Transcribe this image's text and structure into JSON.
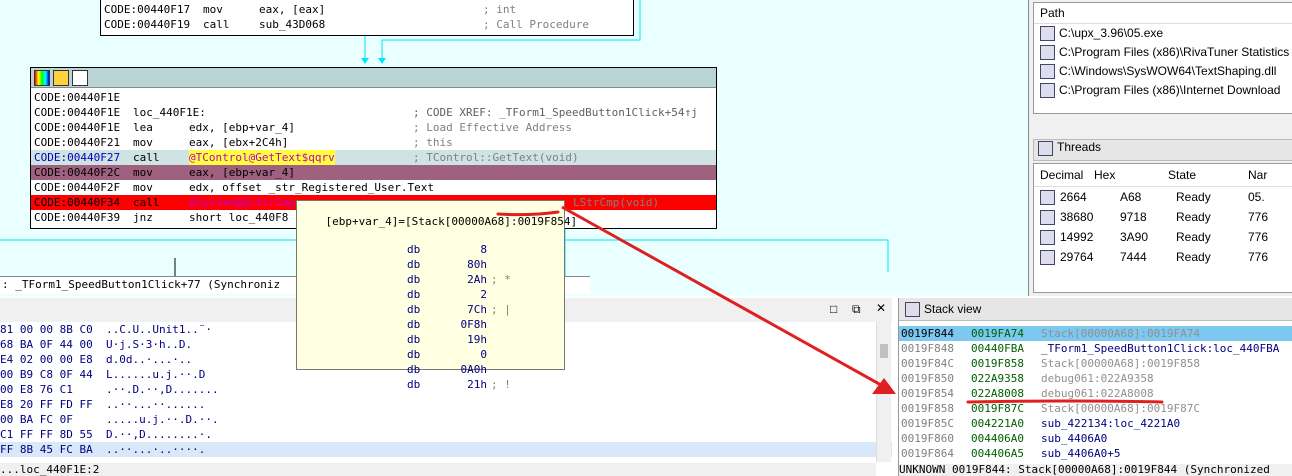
{
  "graph": {
    "top_node": {
      "lines": [
        {
          "addr": "CODE:00440F17",
          "mn": "mov",
          "op": "eax, [eax]",
          "cmt": "; int"
        },
        {
          "addr": "CODE:00440F19",
          "mn": "call",
          "op": "sub_43D068",
          "cmt": "; Call Procedure"
        }
      ]
    },
    "main_node": {
      "lines": [
        {
          "addr": "CODE:00440F1E",
          "mn": "",
          "op": "",
          "cmt": ""
        },
        {
          "addr": "CODE:00440F1E",
          "mn": "loc_440F1E:",
          "op": "",
          "cmt": "; CODE XREF: _TForm1_SpeedButton1Click+54↑j"
        },
        {
          "addr": "CODE:00440F1E",
          "mn": "lea",
          "op": "edx, [ebp+var_4]",
          "cmt": "; Load Effective Address"
        },
        {
          "addr": "CODE:00440F21",
          "mn": "mov",
          "op": "eax, [ebx+2C4h]",
          "cmt": "; this"
        },
        {
          "addr": "CODE:00440F27",
          "mn": "call",
          "op": "@TControl@GetText$qqrv",
          "cmt": "; TControl::GetText(void)"
        },
        {
          "addr": "CODE:00440F2C",
          "mn": "mov",
          "op": "eax, [ebp+var_4]",
          "cmt": ""
        },
        {
          "addr": "CODE:00440F2F",
          "mn": "mov",
          "op": "edx, offset _str_Registered_User.Text",
          "cmt": ""
        },
        {
          "addr": "CODE:00440F34",
          "mn": "call",
          "op": "@System@@LStrCmp",
          "cmt": "LStrCmp(void)"
        },
        {
          "addr": "CODE:00440F39",
          "mn": "jnz",
          "op": "short loc_440F8",
          "cmt": ""
        }
      ]
    }
  },
  "tooltip": {
    "header_prefix": "[ebp+var_4]=[Stack[00000A68]:",
    "header_addr": "0019F854",
    "header_suffix": "]",
    "lines": [
      {
        "kw": "db",
        "val": "8",
        "cmt": ""
      },
      {
        "kw": "db",
        "val": "80h",
        "cmt": ""
      },
      {
        "kw": "db",
        "val": "2Ah",
        "cmt": "; *"
      },
      {
        "kw": "db",
        "val": "2",
        "cmt": ""
      },
      {
        "kw": "db",
        "val": "7Ch",
        "cmt": "; |"
      },
      {
        "kw": "db",
        "val": "0F8h",
        "cmt": ""
      },
      {
        "kw": "db",
        "val": "19h",
        "cmt": ""
      },
      {
        "kw": "db",
        "val": "0",
        "cmt": ""
      },
      {
        "kw": "db",
        "val": "0A0h",
        "cmt": ""
      },
      {
        "kw": "db",
        "val": "21h",
        "cmt": "; !"
      }
    ]
  },
  "status_bar": {
    "text": ": _TForm1_SpeedButton1Click+77 (Synchroniz"
  },
  "modules": {
    "header": "Path",
    "items": [
      "C:\\upx_3.96\\05.exe",
      "C:\\Program Files (x86)\\RivaTuner Statistics",
      "C:\\Windows\\SysWOW64\\TextShaping.dll",
      "C:\\Program Files (x86)\\Internet Download"
    ]
  },
  "threads": {
    "title": "Threads",
    "columns": [
      "Decimal",
      "Hex",
      "State",
      "Nar"
    ],
    "rows": [
      {
        "dec": "2664",
        "hex": "A68",
        "state": "Ready",
        "name": "05."
      },
      {
        "dec": "38680",
        "hex": "9718",
        "state": "Ready",
        "name": "776"
      },
      {
        "dec": "14992",
        "hex": "3A90",
        "state": "Ready",
        "name": "776"
      },
      {
        "dec": "29764",
        "hex": "7444",
        "state": "Ready",
        "name": "776"
      }
    ]
  },
  "hex_view": {
    "rows": [
      {
        "bytes": "81 00 00 8B C0",
        "ascii": "..C.U..Unit1..¨·"
      },
      {
        "bytes": "68 BA 0F 44 00",
        "ascii": "U·j.S·3·h..D."
      },
      {
        "bytes": "E4 02 00 00 E8",
        "ascii": "d.0d..·...·.."
      },
      {
        "bytes": "00 B9 C8 0F 44",
        "ascii": "L......u.j.··.D"
      },
      {
        "bytes": "00 E8 76 C1",
        "ascii": ".··.D.··,D......."
      },
      {
        "bytes": "E8 20 FF FD FF",
        "ascii": "..··...··......"
      },
      {
        "bytes": "00 BA FC 0F",
        "ascii": ".....u.j.··.D.··."
      },
      {
        "bytes": "C1 FF FF 8D 55",
        "ascii": "D.··,D........·."
      },
      {
        "bytes": "FF 8B 45 FC BA",
        "ascii": "..··...·..····."
      }
    ],
    "footer": "...loc_440F1E:2"
  },
  "stack": {
    "title": "Stack view",
    "rows": [
      {
        "addr": "0019F844",
        "val": "0019FA74",
        "cmt": "Stack[00000A68]:0019FA74",
        "sel": true,
        "gray": true
      },
      {
        "addr": "0019F848",
        "val": "00440FBA",
        "cmt": "_TForm1_SpeedButton1Click:loc_440FBA",
        "sel": false,
        "gray": false
      },
      {
        "addr": "0019F84C",
        "val": "0019F858",
        "cmt": "Stack[00000A68]:0019F858",
        "sel": false,
        "gray": true
      },
      {
        "addr": "0019F850",
        "val": "022A9358",
        "cmt": "debug061:022A9358",
        "sel": false,
        "gray": true
      },
      {
        "addr": "0019F854",
        "val": "022A8008",
        "cmt": "debug061:022A8008",
        "sel": false,
        "gray": true
      },
      {
        "addr": "0019F858",
        "val": "0019F87C",
        "cmt": "Stack[00000A68]:0019F87C",
        "sel": false,
        "gray": true
      },
      {
        "addr": "0019F85C",
        "val": "004221A0",
        "cmt": "sub_422134:loc_4221A0",
        "sel": false,
        "gray": false
      },
      {
        "addr": "0019F860",
        "val": "004406A0",
        "cmt": "sub_4406A0",
        "sel": false,
        "gray": false
      },
      {
        "addr": "0019F864",
        "val": "004406A5",
        "cmt": "sub_4406A0+5",
        "sel": false,
        "gray": false
      }
    ],
    "footer": "UNKNOWN 0019F844: Stack[00000A68]:0019F844 (Synchronized"
  },
  "colors": {
    "annotation": "#e02020",
    "current_line": "#ff0000",
    "hl_row": "#a06080",
    "grid_bg": "#eaffff"
  }
}
